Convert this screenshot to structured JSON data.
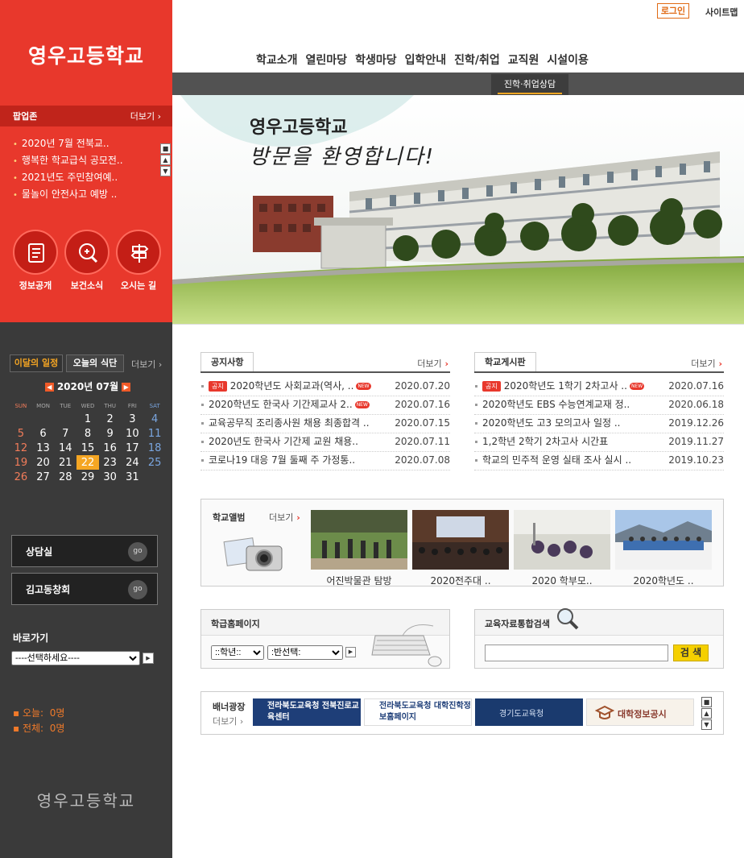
{
  "school_name": "영우고등학교",
  "top": {
    "login": "로그인",
    "sitemap": "사이트맵"
  },
  "gnb": [
    "학교소개",
    "열린마당",
    "학생마당",
    "입학안내",
    "진학/취업",
    "교직원",
    "시설이용"
  ],
  "subtab": "진학·취업상담",
  "hero": {
    "title": "영우고등학교",
    "subtitle": "방문을 환영합니다!"
  },
  "popup": {
    "title": "팝업존",
    "more": "더보기",
    "items": [
      "2020년 7월 전북교..",
      "행복한 학교급식 공모전..",
      "2021년도 주민참여예..",
      "물놀이 안전사고 예방 .."
    ]
  },
  "quick": [
    {
      "label": "정보공개",
      "icon": "book-icon"
    },
    {
      "label": "보건소식",
      "icon": "health-icon"
    },
    {
      "label": "오시는 길",
      "icon": "signpost-icon"
    }
  ],
  "calendar": {
    "tab1": "이달의 일정",
    "tab2": "오늘의 식단",
    "more": "더보기",
    "month": "2020년 07월",
    "days": [
      "SUN",
      "MON",
      "TUE",
      "WED",
      "THU",
      "FRI",
      "SAT"
    ],
    "weeks": [
      [
        "",
        "",
        "",
        "1",
        "2",
        "3",
        "4"
      ],
      [
        "5",
        "6",
        "7",
        "8",
        "9",
        "10",
        "11"
      ],
      [
        "12",
        "13",
        "14",
        "15",
        "16",
        "17",
        "18"
      ],
      [
        "19",
        "20",
        "21",
        "22",
        "23",
        "24",
        "25"
      ],
      [
        "26",
        "27",
        "28",
        "29",
        "30",
        "31",
        ""
      ]
    ],
    "today": "22"
  },
  "side_boxes": [
    {
      "label": "상담실",
      "go": "go"
    },
    {
      "label": "김고동창회",
      "go": "go"
    }
  ],
  "baro": {
    "title": "바로가기",
    "select": "----선택하세요----"
  },
  "visitors": {
    "today_label": "오늘:",
    "today": "0명",
    "total_label": "전체:",
    "total": "0명"
  },
  "footer_logo": "영우고등학교",
  "notice": {
    "title": "공지사항",
    "more": "더보기",
    "items": [
      {
        "badge": "공지",
        "title": "2020학년도 사회교과(역사, ..",
        "new": true,
        "date": "2020.07.20"
      },
      {
        "badge": "",
        "title": "2020학년도 한국사 기간제교사 2..",
        "new": true,
        "date": "2020.07.16"
      },
      {
        "badge": "",
        "title": "교육공무직 조리종사원 채용 최종합격 ..",
        "new": false,
        "date": "2020.07.15"
      },
      {
        "badge": "",
        "title": "2020년도 한국사 기간제 교원 채용..",
        "new": false,
        "date": "2020.07.11"
      },
      {
        "badge": "",
        "title": "코로나19 대응 7월 둘째 주 가정통..",
        "new": false,
        "date": "2020.07.08"
      }
    ]
  },
  "board": {
    "title": "학교게시판",
    "more": "더보기",
    "items": [
      {
        "badge": "공지",
        "title": "2020학년도 1학기 2차고사 ..",
        "new": true,
        "date": "2020.07.16"
      },
      {
        "badge": "",
        "title": "2020학년도 EBS 수능연계교재 정..",
        "new": false,
        "date": "2020.06.18"
      },
      {
        "badge": "",
        "title": "2020학년도 고3 모의고사 일정 ..",
        "new": false,
        "date": "2019.12.26"
      },
      {
        "badge": "",
        "title": "1,2학년 2학기 2차고사 시간표",
        "new": false,
        "date": "2019.11.27"
      },
      {
        "badge": "",
        "title": "학교의 민주적 운영 실태 조사 실시 ..",
        "new": false,
        "date": "2019.10.23"
      }
    ]
  },
  "album": {
    "title": "학교앨범",
    "more": "더보기",
    "items": [
      "어진박물관 탐방",
      "2020전주대 ..",
      "2020 학부모..",
      "2020학년도 .."
    ]
  },
  "class_home": {
    "title": "학급홈페이지",
    "grade": "::학년::",
    "class": ":반선택:"
  },
  "edu_search": {
    "title": "교육자료통합검색",
    "button": "검 색"
  },
  "banner": {
    "title": "배너광장",
    "more": "더보기",
    "items": [
      "전라북도교육청 전북진로교육센터",
      "전라북도교육청 대학진학정보홈페이지",
      "경기도교육청",
      "대학정보공시"
    ]
  },
  "colors": {
    "red": "#e8382c",
    "dark": "#3a3a3a",
    "accent": "#f6a623"
  }
}
